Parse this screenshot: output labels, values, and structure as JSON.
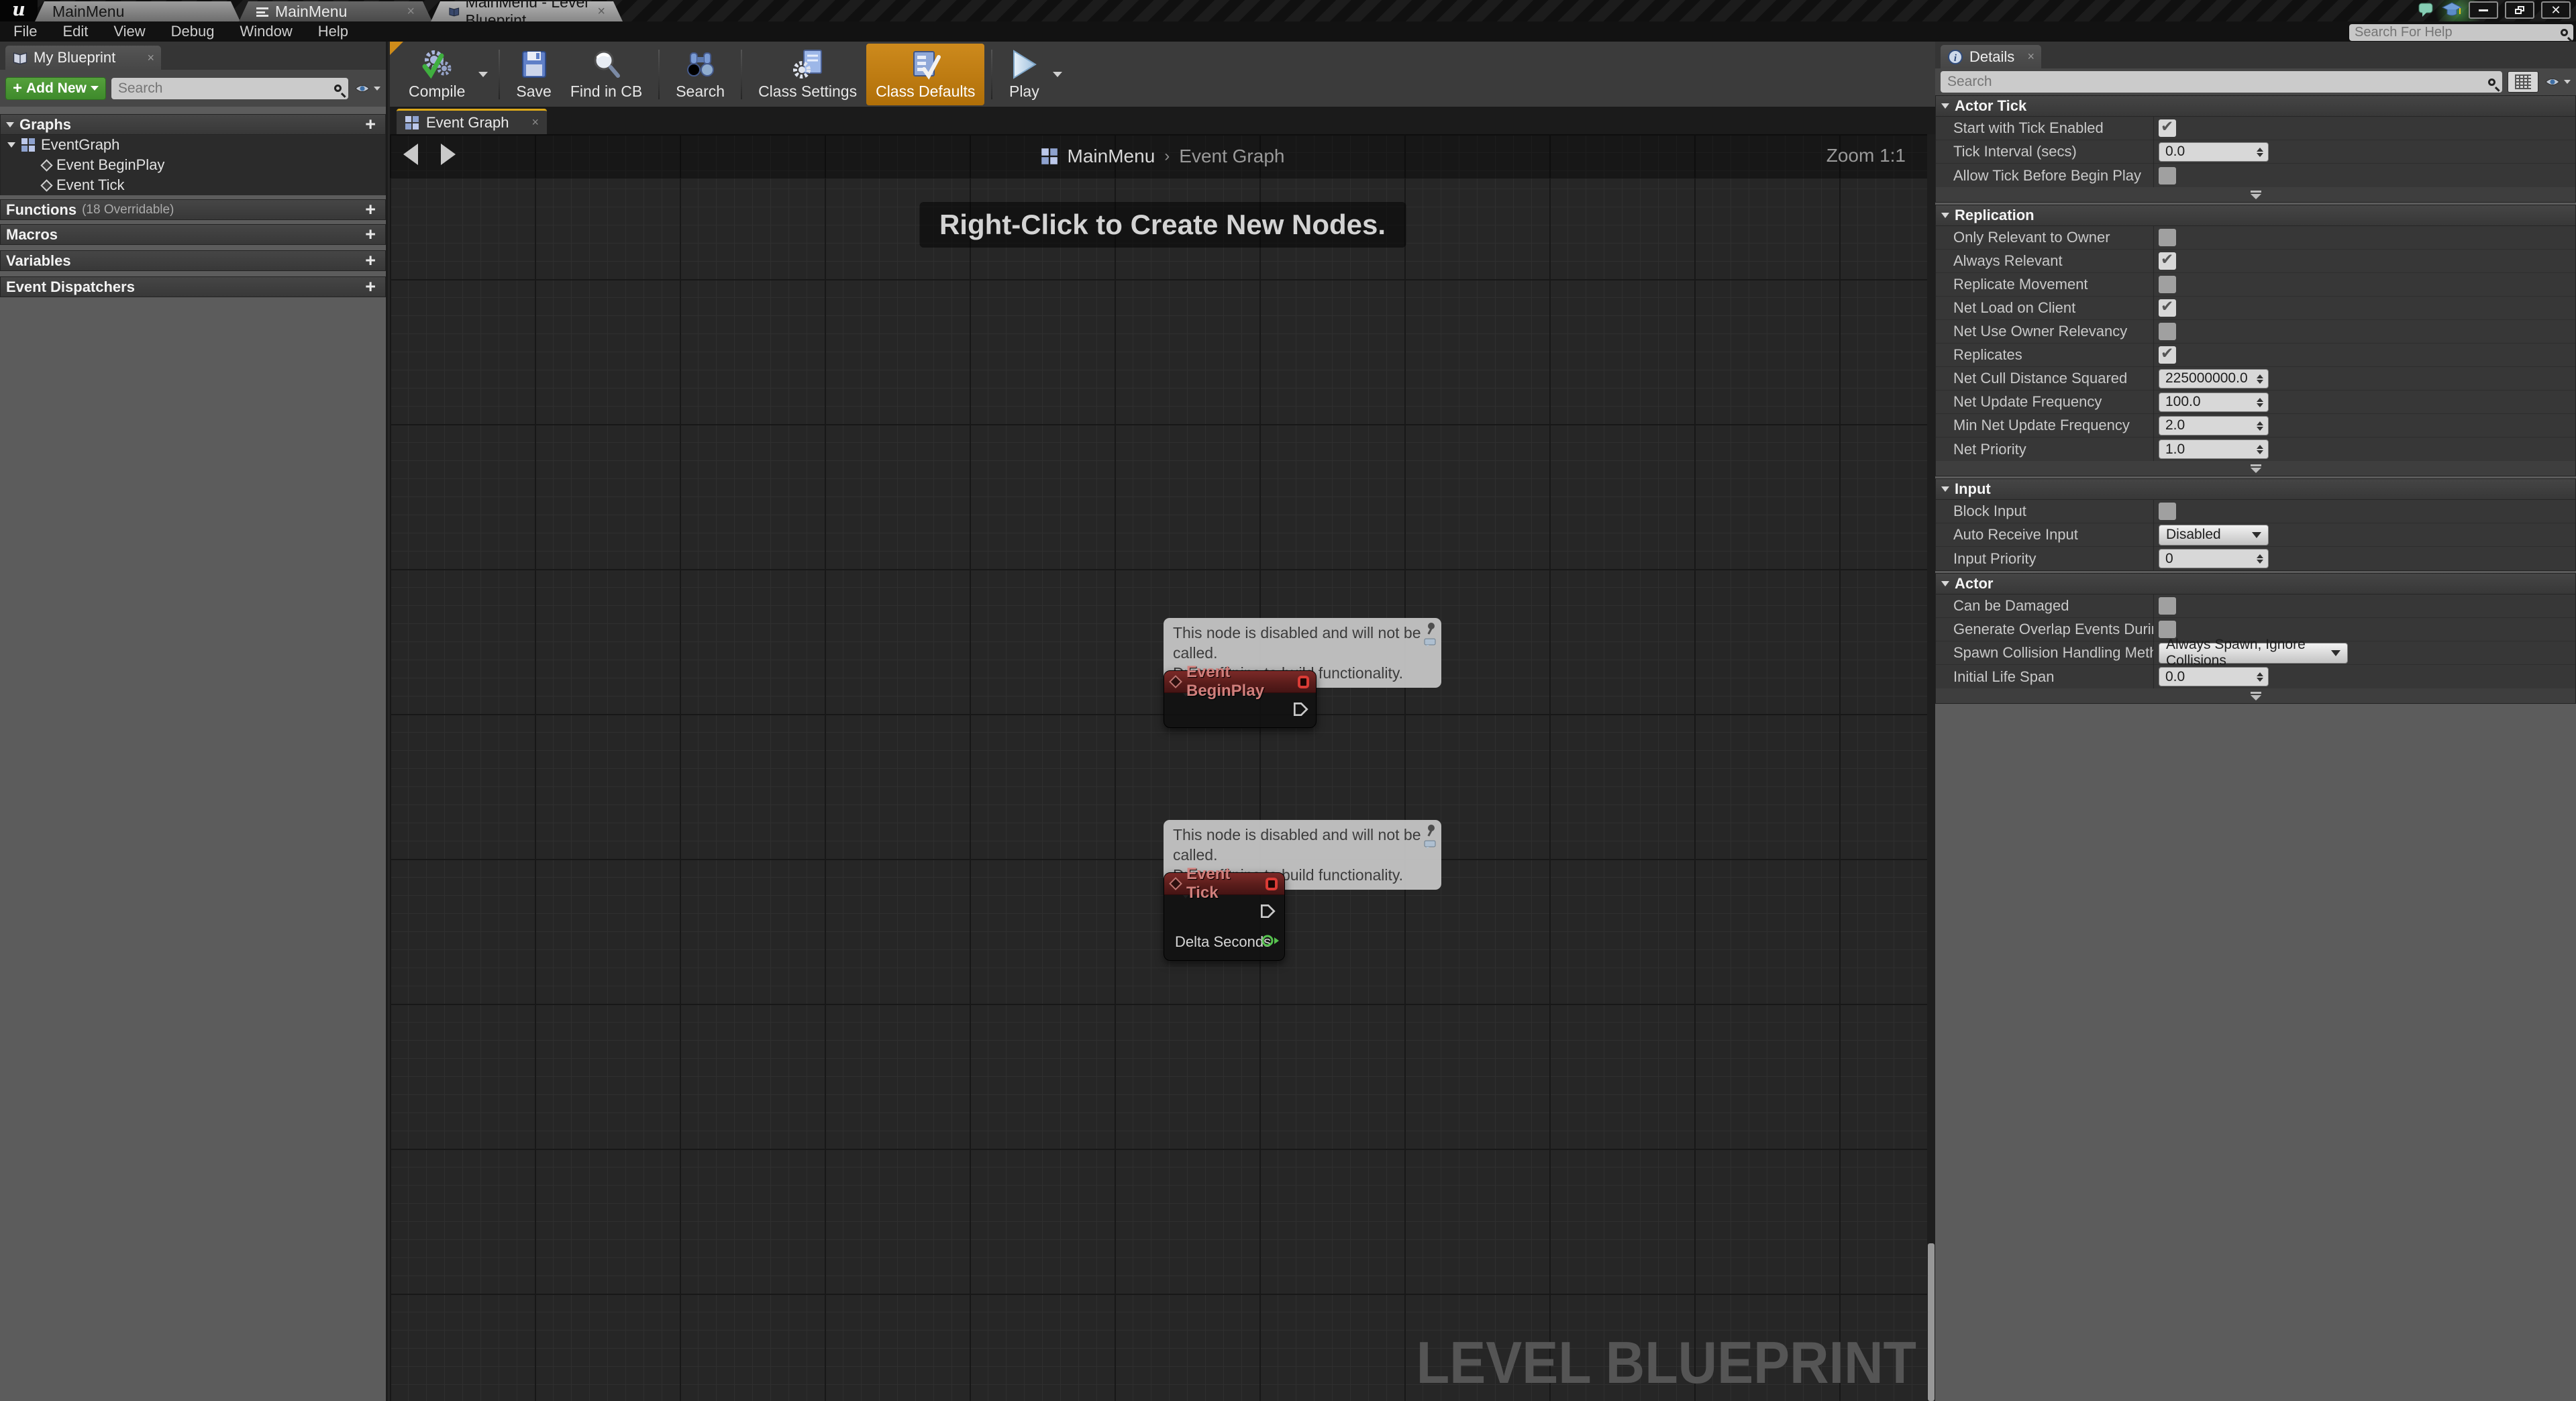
{
  "titlebar": {
    "tabs": [
      {
        "label": "MainMenu",
        "active": false,
        "closable": false
      },
      {
        "label": "MainMenu",
        "active": false,
        "closable": true
      },
      {
        "label": "MainMenu - Level Blueprint",
        "active": true,
        "closable": true
      }
    ],
    "help_search_placeholder": "Search For Help"
  },
  "menubar": {
    "items": [
      "File",
      "Edit",
      "View",
      "Debug",
      "Window",
      "Help"
    ]
  },
  "toolbar": {
    "compile_label": "Compile",
    "save_label": "Save",
    "find_in_cb_label": "Find in CB",
    "search_label": "Search",
    "class_settings_label": "Class Settings",
    "class_defaults_label": "Class Defaults",
    "play_label": "Play",
    "active_button": "Class Defaults",
    "active_color": "#c07e17"
  },
  "my_blueprint": {
    "tab_label": "My Blueprint",
    "add_new_label": "Add New",
    "search_placeholder": "Search",
    "graphs_header": "Graphs",
    "tree": {
      "graph_label": "EventGraph",
      "events": [
        "Event BeginPlay",
        "Event Tick"
      ]
    },
    "functions_header": "Functions",
    "functions_suffix": "(18 Overridable)",
    "macros_header": "Macros",
    "variables_header": "Variables",
    "event_dispatchers_header": "Event Dispatchers"
  },
  "graph": {
    "tab_label": "Event Graph",
    "breadcrumb": {
      "root": "MainMenu",
      "separator": "›",
      "current": "Event Graph"
    },
    "zoom_label": "Zoom 1:1",
    "hint": "Right-Click to Create New Nodes.",
    "watermark": "LEVEL BLUEPRINT",
    "warning": {
      "line1": "This node is disabled and will not be called.",
      "line2": "Drag off pins to build functionality."
    },
    "nodes": [
      {
        "title": "Event BeginPlay",
        "disabled": true,
        "pins": [
          "exec-out"
        ]
      },
      {
        "title": "Event Tick",
        "disabled": true,
        "pins": [
          "exec-out",
          "float-out"
        ],
        "float_pin_label": "Delta Seconds"
      }
    ],
    "node_title_color": "#7c2a28",
    "float_pin_color": "#57c34f"
  },
  "details": {
    "tab_label": "Details",
    "search_placeholder": "Search",
    "sections": [
      {
        "title": "Actor Tick",
        "rows": [
          {
            "label": "Start with Tick Enabled",
            "control": "checkbox",
            "value": true
          },
          {
            "label": "Tick Interval (secs)",
            "control": "number",
            "value": "0.0"
          },
          {
            "label": "Allow Tick Before Begin Play",
            "control": "checkbox",
            "value": false
          }
        ]
      },
      {
        "title": "Replication",
        "rows": [
          {
            "label": "Only Relevant to Owner",
            "control": "checkbox",
            "value": false
          },
          {
            "label": "Always Relevant",
            "control": "checkbox",
            "value": true
          },
          {
            "label": "Replicate Movement",
            "control": "checkbox",
            "value": false
          },
          {
            "label": "Net Load on Client",
            "control": "checkbox",
            "value": true
          },
          {
            "label": "Net Use Owner Relevancy",
            "control": "checkbox",
            "value": false
          },
          {
            "label": "Replicates",
            "control": "checkbox",
            "value": true
          },
          {
            "label": "Net Cull Distance Squared",
            "control": "number",
            "value": "225000000.0"
          },
          {
            "label": "Net Update Frequency",
            "control": "number",
            "value": "100.0"
          },
          {
            "label": "Min Net Update Frequency",
            "control": "number",
            "value": "2.0"
          },
          {
            "label": "Net Priority",
            "control": "number",
            "value": "1.0"
          }
        ]
      },
      {
        "title": "Input",
        "rows": [
          {
            "label": "Block Input",
            "control": "checkbox",
            "value": false
          },
          {
            "label": "Auto Receive Input",
            "control": "dropdown",
            "value": "Disabled"
          },
          {
            "label": "Input Priority",
            "control": "number",
            "value": "0"
          }
        ]
      },
      {
        "title": "Actor",
        "rows": [
          {
            "label": "Can be Damaged",
            "control": "checkbox",
            "value": false
          },
          {
            "label": "Generate Overlap Events During Level S",
            "control": "checkbox",
            "value": false
          },
          {
            "label": "Spawn Collision Handling Method",
            "control": "dropdown",
            "value": "Always Spawn, Ignore Collisions"
          },
          {
            "label": "Initial Life Span",
            "control": "number",
            "value": "0.0"
          }
        ]
      }
    ]
  }
}
